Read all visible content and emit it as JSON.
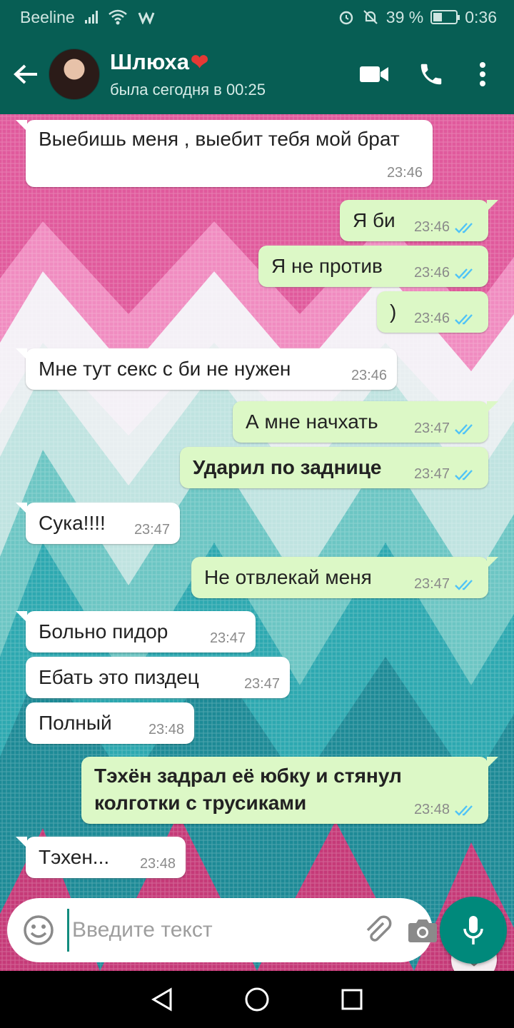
{
  "status_bar": {
    "carrier": "Beeline",
    "battery_text": "39 %",
    "battery_level": 0.39,
    "time": "0:36"
  },
  "header": {
    "contact_name": "Шлюха",
    "contact_emoji": "❤",
    "contact_status": "была сегодня в 00:25",
    "icons": [
      "back-arrow-icon",
      "video-call-icon",
      "phone-icon",
      "more-options-icon"
    ]
  },
  "messages": [
    {
      "dir": "in",
      "text": "Выебишь меня , выебит тебя мой брат",
      "time": "23:46",
      "bold": false,
      "tail": true
    },
    {
      "dir": "out",
      "text": "Я би",
      "time": "23:46",
      "bold": false,
      "tail": true
    },
    {
      "dir": "out",
      "text": "Я не против",
      "time": "23:46",
      "bold": false,
      "tail": false
    },
    {
      "dir": "out",
      "text": ")",
      "time": "23:46",
      "bold": false,
      "tail": false
    },
    {
      "dir": "in",
      "text": "Мне тут секс с би не нужен",
      "time": "23:46",
      "bold": false,
      "tail": true
    },
    {
      "dir": "out",
      "text": "А мне начхать",
      "time": "23:47",
      "bold": false,
      "tail": true
    },
    {
      "dir": "out",
      "text": "Ударил по заднице",
      "time": "23:47",
      "bold": true,
      "tail": false
    },
    {
      "dir": "in",
      "text": "Сука!!!!",
      "time": "23:47",
      "bold": false,
      "tail": true
    },
    {
      "dir": "out",
      "text": "Не отвлекай меня",
      "time": "23:47",
      "bold": false,
      "tail": true
    },
    {
      "dir": "in",
      "text": "Больно пидор",
      "time": "23:47",
      "bold": false,
      "tail": true
    },
    {
      "dir": "in",
      "text": "Ебать это пиздец",
      "time": "23:47",
      "bold": false,
      "tail": false
    },
    {
      "dir": "in",
      "text": "Полный",
      "time": "23:48",
      "bold": false,
      "tail": false
    },
    {
      "dir": "out",
      "text": "Тэхён задрал её юбку и стянул колготки с трусиками",
      "time": "23:48",
      "bold": true,
      "tail": true
    },
    {
      "dir": "in",
      "text": "Тэхен...",
      "time": "23:48",
      "bold": false,
      "tail": true
    }
  ],
  "input": {
    "placeholder": "Введите текст",
    "value": ""
  },
  "colors": {
    "header": "#075e54",
    "outgoing": "#dcf8c6",
    "incoming": "#ffffff",
    "accent": "#00897b",
    "ticks": "#4fc3f7"
  }
}
